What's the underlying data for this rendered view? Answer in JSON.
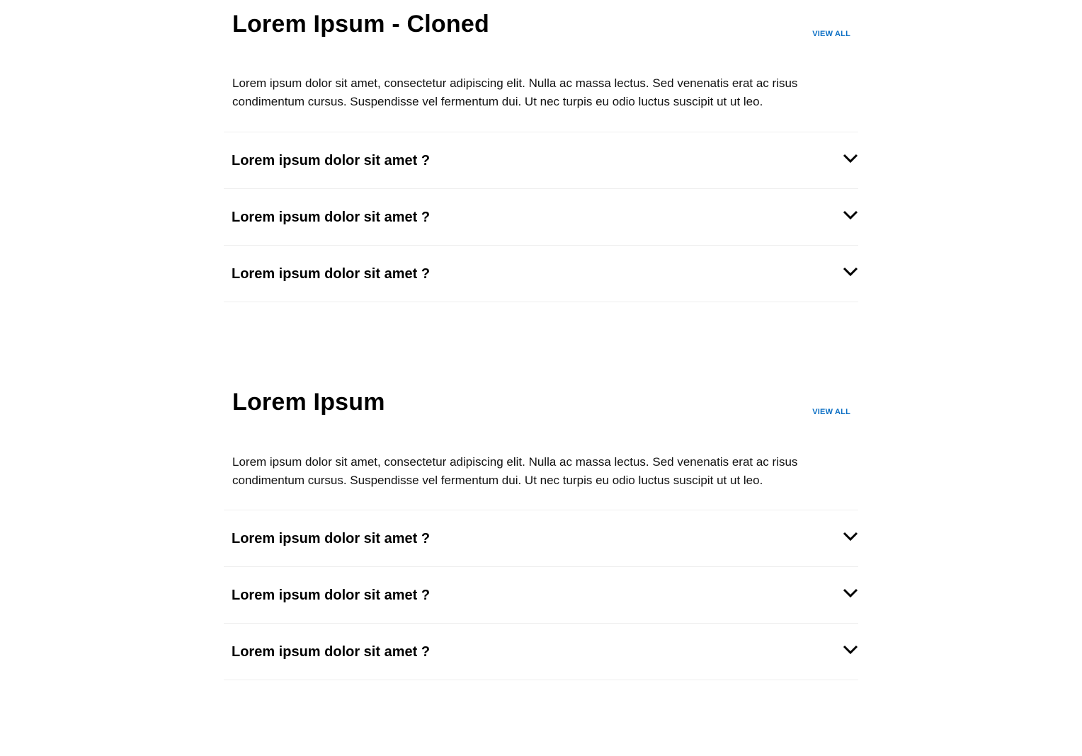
{
  "sections": [
    {
      "title": "Lorem Ipsum - Cloned",
      "view_all": "VIEW ALL",
      "description": "Lorem ipsum dolor sit amet, consectetur adipiscing elit. Nulla ac massa lectus. Sed venenatis erat ac risus condimentum cursus. Suspendisse vel fermentum dui. Ut nec turpis eu odio luctus suscipit ut ut leo.",
      "items": [
        {
          "question": "Lorem ipsum dolor sit amet ?",
          "icon": "chevron-down-icon"
        },
        {
          "question": "Lorem ipsum dolor sit amet ?",
          "icon": "chevron-down-icon"
        },
        {
          "question": "Lorem ipsum dolor sit amet ?",
          "icon": "chevron-down-icon"
        }
      ]
    },
    {
      "title": "Lorem Ipsum",
      "view_all": "VIEW ALL",
      "description": "Lorem ipsum dolor sit amet, consectetur adipiscing elit. Nulla ac massa lectus. Sed venenatis erat ac risus condimentum cursus. Suspendisse vel fermentum dui. Ut nec turpis eu odio luctus suscipit ut ut leo.",
      "items": [
        {
          "question": "Lorem ipsum dolor sit amet ?",
          "icon": "chevron-down-icon"
        },
        {
          "question": "Lorem ipsum dolor sit amet ?",
          "icon": "chevron-down-icon"
        },
        {
          "question": "Lorem ipsum dolor sit amet ?",
          "icon": "chevron-down-icon"
        }
      ]
    }
  ],
  "colors": {
    "link": "#0b6fc4",
    "text": "#000000",
    "divider": "#eeeeee"
  }
}
